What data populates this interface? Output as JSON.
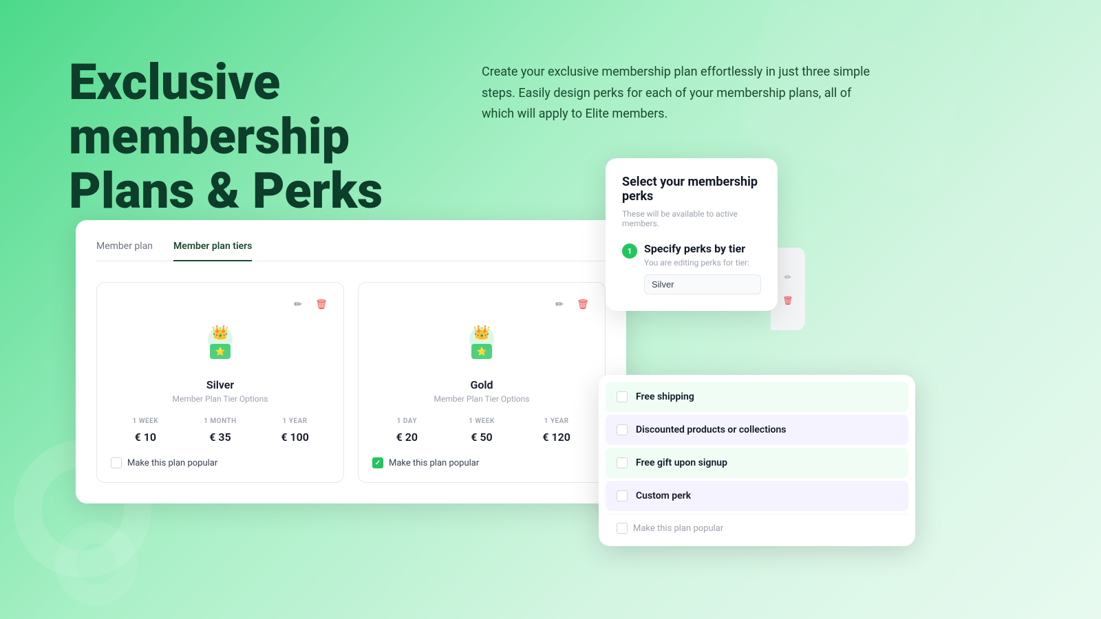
{
  "page": {
    "title": "Exclusive membership Plans & Perks",
    "description": "Create your exclusive membership plan effortlessly in just three simple steps. Easily design perks for each of your membership plans, all of which will apply to Elite members."
  },
  "tabs": {
    "items": [
      {
        "label": "Member plan",
        "active": false
      },
      {
        "label": "Member plan tiers",
        "active": true
      }
    ]
  },
  "plans": [
    {
      "name": "Silver",
      "subtitle": "Member Plan Tier Options",
      "pricing": [
        {
          "period": "1 WEEK",
          "amount": "€ 10"
        },
        {
          "period": "1 MONTH",
          "amount": "€ 35"
        },
        {
          "period": "1 YEAR",
          "amount": "€ 100"
        }
      ],
      "makePopular": false,
      "makePopularLabel": "Make this plan popular"
    },
    {
      "name": "Gold",
      "subtitle": "Member Plan Tier Options",
      "pricing": [
        {
          "period": "1 DAY",
          "amount": "€ 20"
        },
        {
          "period": "1 WEEK",
          "amount": "€ 50"
        },
        {
          "period": "1 YEAR",
          "amount": "€ 120"
        }
      ],
      "makePopular": true,
      "makePopularLabel": "Make this plan popular"
    }
  ],
  "perksSelectCard": {
    "title": "Select your membership perks",
    "subtitle": "These will be available to active members.",
    "specifyTitle": "Specify perks by tier",
    "specifyDescription": "You are editing perks for tier:",
    "stepNumber": "1",
    "tierValue": "Silver",
    "tierPlaceholder": "Silver"
  },
  "perksList": {
    "items": [
      {
        "label": "Free shipping",
        "checked": false
      },
      {
        "label": "Discounted products or collections",
        "checked": false
      },
      {
        "label": "Free gift upon signup",
        "checked": false
      },
      {
        "label": "Custom perk",
        "checked": false
      }
    ],
    "footerLabel": "Make this plan popular"
  },
  "icons": {
    "edit": "✏",
    "delete": "🗑",
    "check": "✓"
  }
}
